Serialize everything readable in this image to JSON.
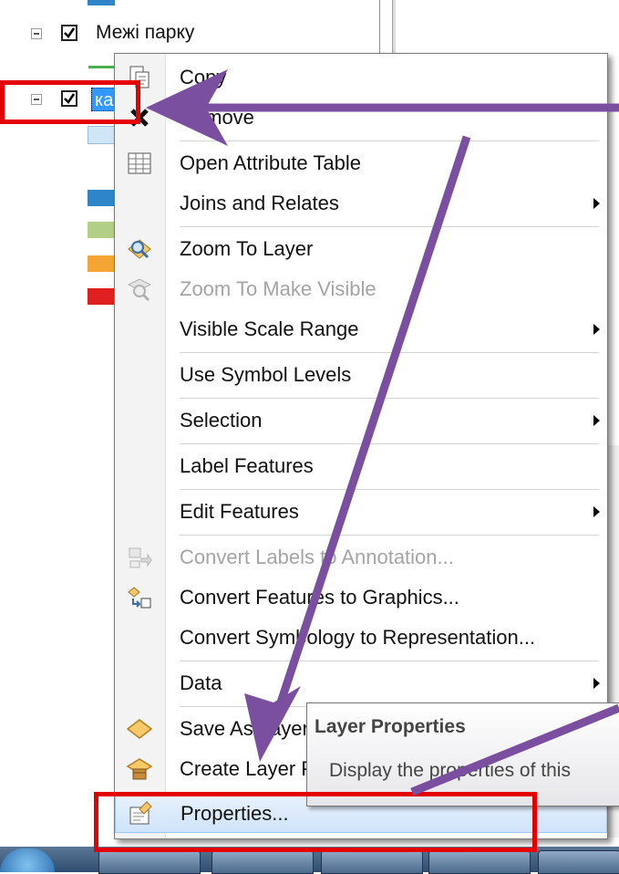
{
  "toc": {
    "layer1_label": "Межі парку",
    "layer2_label_partial": "ка",
    "swatch_colors": [
      "#2e86c8",
      "#b3cf86",
      "#f4a533",
      "#e02020"
    ]
  },
  "menu": {
    "items": [
      {
        "label": "Copy",
        "icon": "copy-icon"
      },
      {
        "label": "Remove",
        "icon": "remove-icon"
      },
      {
        "label": "Open Attribute Table",
        "icon": "table-icon"
      },
      {
        "label": "Joins and Relates",
        "submenu": true
      },
      {
        "label": "Zoom To Layer",
        "icon": "zoom-to-layer-icon"
      },
      {
        "label": "Zoom To Make Visible",
        "icon": "zoom-visible-icon",
        "disabled": true
      },
      {
        "label": "Visible Scale Range",
        "submenu": true
      },
      {
        "label": "Use Symbol Levels"
      },
      {
        "label": "Selection",
        "submenu": true
      },
      {
        "label": "Label Features"
      },
      {
        "label": "Edit Features",
        "submenu": true
      },
      {
        "label": "Convert Labels to Annotation...",
        "icon": "convert-labels-icon",
        "disabled": true
      },
      {
        "label": "Convert Features to Graphics...",
        "icon": "convert-graphics-icon"
      },
      {
        "label": "Convert Symbology to Representation..."
      },
      {
        "label": "Data",
        "submenu": true
      },
      {
        "label": "Save As Layer File...",
        "icon": "save-layer-icon"
      },
      {
        "label": "Create Layer Package...",
        "icon": "layer-package-icon"
      },
      {
        "label": "Properties...",
        "icon": "properties-icon",
        "highlighted": true
      }
    ]
  },
  "tooltip": {
    "title": "Layer Properties",
    "description": "Display the properties of this"
  },
  "colors": {
    "annotation_red": "#e50000",
    "arrow_purple": "#7b4fa0",
    "highlight": "#cfe3fa"
  }
}
